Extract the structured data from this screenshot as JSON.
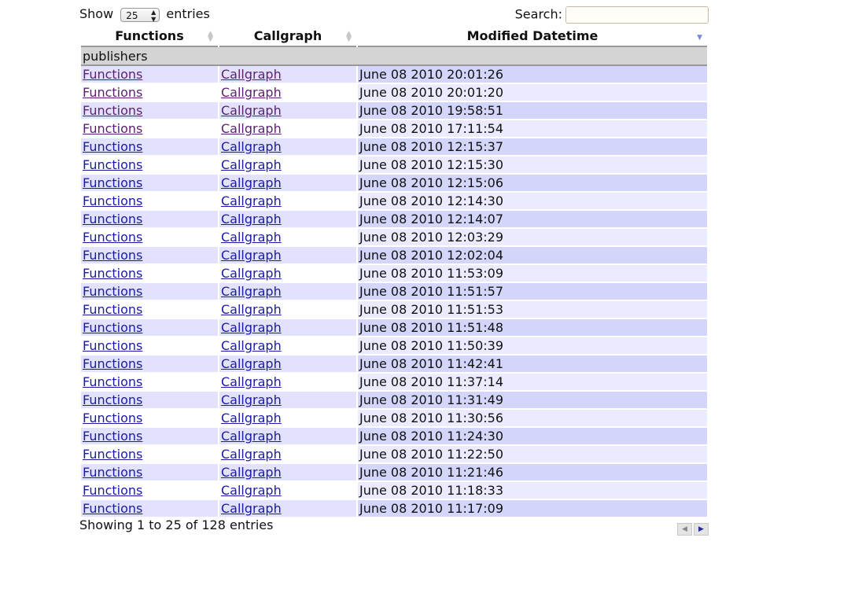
{
  "length": {
    "show": "Show",
    "value": "25",
    "entries": "entries"
  },
  "search": {
    "label": "Search:",
    "value": ""
  },
  "columns": [
    "Functions",
    "Callgraph",
    "Modified Datetime"
  ],
  "group": "publishers",
  "rows": [
    {
      "f": "Functions",
      "c": "Callgraph",
      "d": "June 08 2010 20:01:26",
      "visited": true
    },
    {
      "f": "Functions",
      "c": "Callgraph",
      "d": "June 08 2010 20:01:20",
      "visited": true
    },
    {
      "f": "Functions",
      "c": "Callgraph",
      "d": "June 08 2010 19:58:51",
      "visited": true
    },
    {
      "f": "Functions",
      "c": "Callgraph",
      "d": "June 08 2010 17:11:54",
      "visited": true
    },
    {
      "f": "Functions",
      "c": "Callgraph",
      "d": "June 08 2010 12:15:37",
      "visited": false
    },
    {
      "f": "Functions",
      "c": "Callgraph",
      "d": "June 08 2010 12:15:30",
      "visited": false
    },
    {
      "f": "Functions",
      "c": "Callgraph",
      "d": "June 08 2010 12:15:06",
      "visited": false
    },
    {
      "f": "Functions",
      "c": "Callgraph",
      "d": "June 08 2010 12:14:30",
      "visited": false
    },
    {
      "f": "Functions",
      "c": "Callgraph",
      "d": "June 08 2010 12:14:07",
      "visited": false
    },
    {
      "f": "Functions",
      "c": "Callgraph",
      "d": "June 08 2010 12:03:29",
      "visited": false
    },
    {
      "f": "Functions",
      "c": "Callgraph",
      "d": "June 08 2010 12:02:04",
      "visited": false
    },
    {
      "f": "Functions",
      "c": "Callgraph",
      "d": "June 08 2010 11:53:09",
      "visited": false
    },
    {
      "f": "Functions",
      "c": "Callgraph",
      "d": "June 08 2010 11:51:57",
      "visited": false
    },
    {
      "f": "Functions",
      "c": "Callgraph",
      "d": "June 08 2010 11:51:53",
      "visited": false
    },
    {
      "f": "Functions",
      "c": "Callgraph",
      "d": "June 08 2010 11:51:48",
      "visited": false
    },
    {
      "f": "Functions",
      "c": "Callgraph",
      "d": "June 08 2010 11:50:39",
      "visited": false
    },
    {
      "f": "Functions",
      "c": "Callgraph",
      "d": "June 08 2010 11:42:41",
      "visited": false
    },
    {
      "f": "Functions",
      "c": "Callgraph",
      "d": "June 08 2010 11:37:14",
      "visited": false
    },
    {
      "f": "Functions",
      "c": "Callgraph",
      "d": "June 08 2010 11:31:49",
      "visited": false
    },
    {
      "f": "Functions",
      "c": "Callgraph",
      "d": "June 08 2010 11:30:56",
      "visited": false
    },
    {
      "f": "Functions",
      "c": "Callgraph",
      "d": "June 08 2010 11:24:30",
      "visited": false
    },
    {
      "f": "Functions",
      "c": "Callgraph",
      "d": "June 08 2010 11:22:50",
      "visited": false
    },
    {
      "f": "Functions",
      "c": "Callgraph",
      "d": "June 08 2010 11:21:46",
      "visited": false
    },
    {
      "f": "Functions",
      "c": "Callgraph",
      "d": "June 08 2010 11:18:33",
      "visited": false
    },
    {
      "f": "Functions",
      "c": "Callgraph",
      "d": "June 08 2010 11:17:09",
      "visited": false
    }
  ],
  "info": "Showing 1 to 25 of 128 entries",
  "icons": {
    "sort": "sort-both-icon",
    "sort_desc": "sort-desc-icon",
    "prev": "previous-arrow-icon",
    "next": "next-arrow-icon"
  },
  "colors": {
    "link": "#1a1aa6",
    "visited": "#5b1f6f",
    "row_odd": "#e2e2ff",
    "sorted_odd": "#d3d5fb",
    "sorted_even": "#eaebff",
    "group_bg": "#d4d4d4"
  }
}
